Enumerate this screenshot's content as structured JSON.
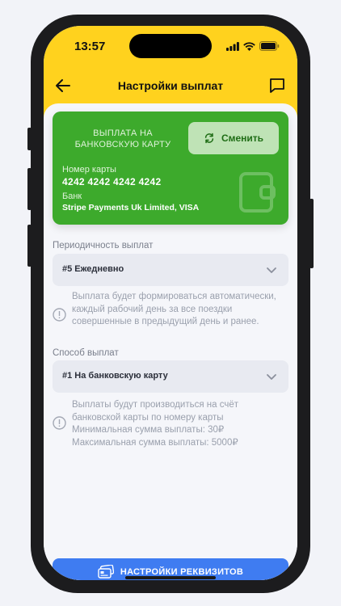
{
  "status": {
    "time": "13:57"
  },
  "nav": {
    "title": "Настройки выплат"
  },
  "card": {
    "payout_title": "ВЫПЛАТА НА БАНКОВСКУЮ КАРТУ",
    "change_label": "Сменить",
    "number_label": "Номер карты",
    "number": "4242 4242 4242 4242",
    "bank_label": "Банк",
    "bank_name": "Stripe Payments Uk Limited, VISA",
    "color": "#3daa2c"
  },
  "periodicity": {
    "label": "Периодичность выплат",
    "selected": "#5 Ежедневно",
    "info": "Выплата будет формироваться автоматически, каждый рабочий день за все поездки совершенные в предыдущий день и ранее."
  },
  "method": {
    "label": "Способ выплат",
    "selected": "#1 На банковскую карту",
    "info_lines": [
      "Выплаты будут производиться на счёт банковской карты по номеру карты",
      "Минимальная сумма выплаты: 30₽",
      "Максимальная сумма выплаты: 5000₽"
    ]
  },
  "footer": {
    "requisites_label": "НАСТРОЙКИ РЕКВИЗИТОВ",
    "accent": "#3f7cf1"
  },
  "icons": [
    "back-arrow-icon",
    "chat-icon",
    "refresh-icon",
    "wallet-icon",
    "chevron-down-icon",
    "info-icon",
    "card-icon"
  ]
}
